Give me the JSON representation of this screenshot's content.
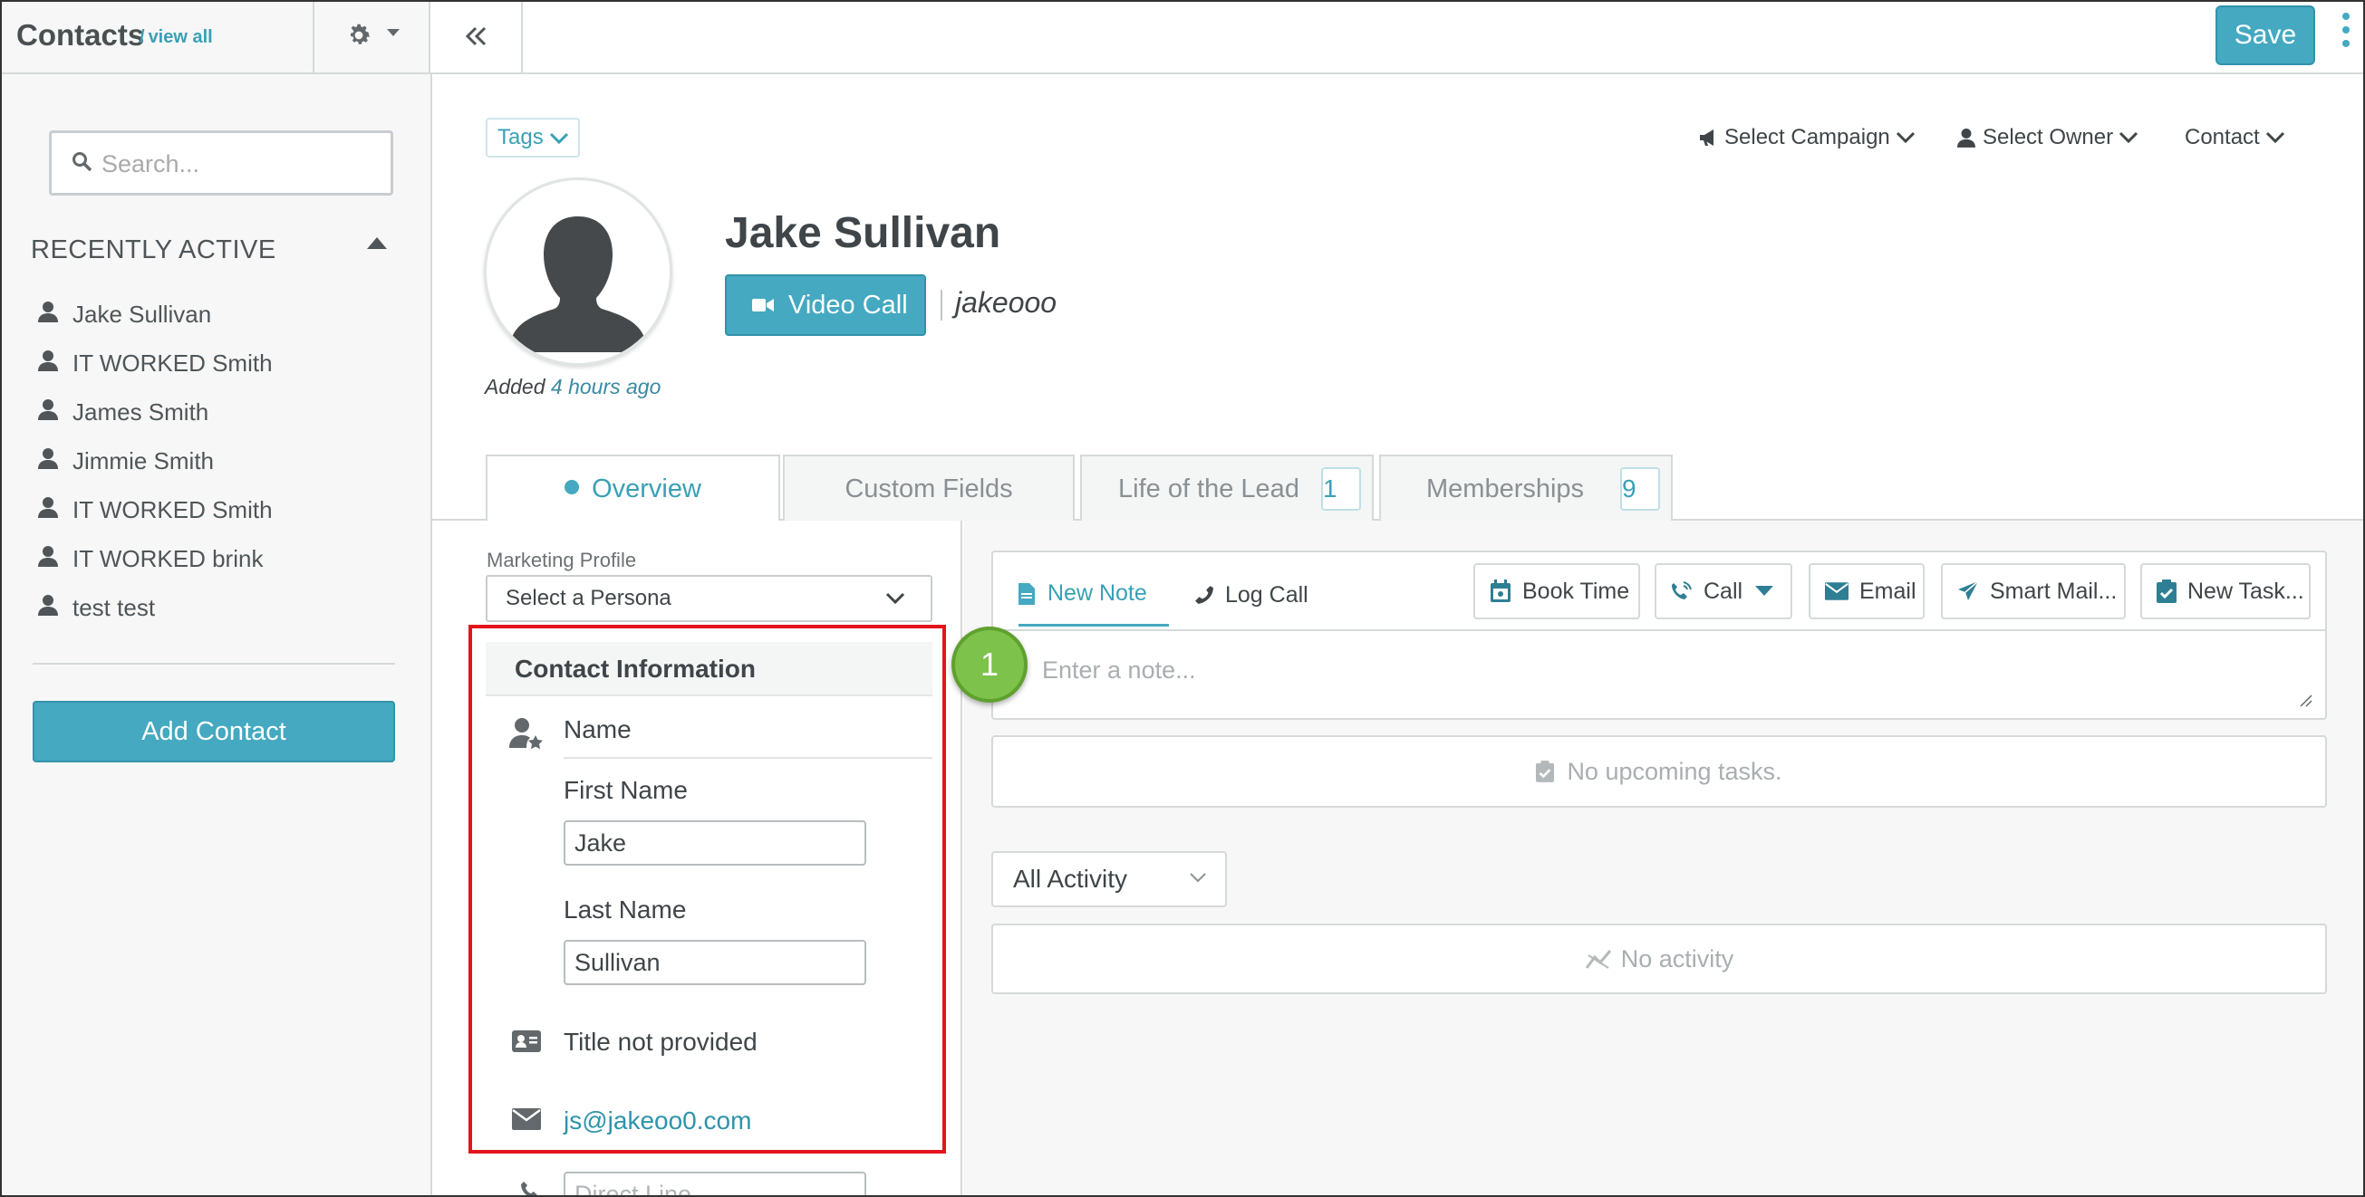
{
  "topbar": {
    "title": "Contacts",
    "view_all": "view all",
    "save_label": "Save"
  },
  "sidebar": {
    "search_placeholder": "Search...",
    "recent_header": "RECENTLY ACTIVE",
    "recent_items": [
      {
        "label": "Jake Sullivan"
      },
      {
        "label": "IT WORKED Smith"
      },
      {
        "label": "James Smith"
      },
      {
        "label": "Jimmie Smith"
      },
      {
        "label": "IT WORKED Smith"
      },
      {
        "label": "IT WORKED brink"
      },
      {
        "label": "test test"
      }
    ],
    "add_contact_label": "Add Contact"
  },
  "header": {
    "tags_label": "Tags",
    "select_campaign": "Select Campaign",
    "select_owner": "Select Owner",
    "contact_menu": "Contact",
    "added_prefix": "Added",
    "added_ago": "4 hours ago",
    "contact_name": "Jake Sullivan",
    "video_call_label": "Video Call",
    "handle": "jakeooo"
  },
  "tabs": [
    {
      "label": "Overview",
      "active": true
    },
    {
      "label": "Custom Fields",
      "active": false
    },
    {
      "label": "Life of the Lead",
      "badge": "1",
      "active": false
    },
    {
      "label": "Memberships",
      "badge": "9",
      "active": false
    }
  ],
  "profile": {
    "marketing_profile_label": "Marketing Profile",
    "persona_value": "Select a Persona",
    "contact_info_header": "Contact Information",
    "name_label": "Name",
    "first_name_label": "First Name",
    "first_name_value": "Jake",
    "last_name_label": "Last Name",
    "last_name_value": "Sullivan",
    "title_text": "Title not provided",
    "email": "js@jakeoo0.com",
    "direct_line_placeholder": "Direct Line"
  },
  "activity": {
    "tab_new_note": "New Note",
    "tab_log_call": "Log Call",
    "btn_book_time": "Book Time",
    "btn_call": "Call",
    "btn_email": "Email",
    "btn_smart_mail": "Smart Mail...",
    "btn_new_task": "New Task...",
    "note_placeholder": "Enter a note...",
    "step_number": "1",
    "no_tasks": "No upcoming tasks.",
    "filter_value": "All Activity",
    "no_activity": "No activity"
  },
  "colors": {
    "accent": "#44a9c1",
    "highlight_box": "#e4141b",
    "step_badge": "#7dc24a"
  }
}
